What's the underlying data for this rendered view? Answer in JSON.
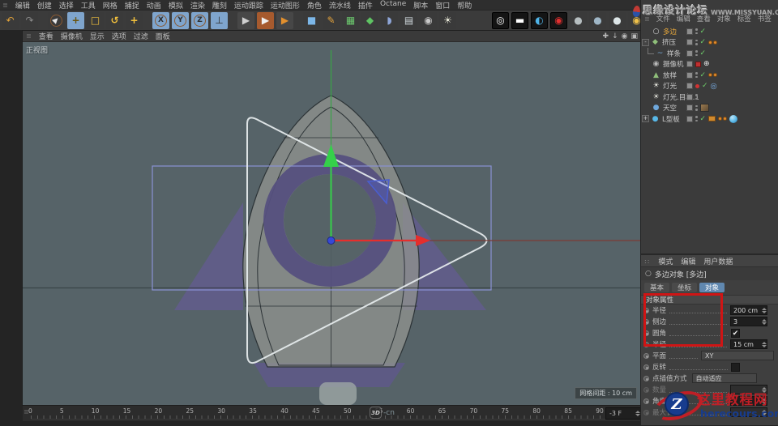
{
  "colors": {
    "highlight-red": "#cf1515",
    "viewport-bg": "#566368",
    "axis-green": "#35d04a",
    "axis-red": "#e62e2c",
    "spline-white": "#e6ecee",
    "workplane-blue": "#8a92d4",
    "fin-purple": "#615c8a",
    "selected-orange": "#e9a93c",
    "active-tab-blue": "#6088b0"
  },
  "menubar": {
    "items": [
      "编辑",
      "创建",
      "选择",
      "工具",
      "网格",
      "捕捉",
      "动画",
      "模拟",
      "渲染",
      "雕刻",
      "运动跟踪",
      "运动图形",
      "角色",
      "流水线",
      "插件",
      "Octane",
      "脚本",
      "窗口",
      "帮助"
    ]
  },
  "toolbar": {
    "icons": [
      {
        "name": "undo-icon",
        "glyph": "↶",
        "fg": "#e0a23a"
      },
      {
        "name": "redo-icon",
        "glyph": "↷",
        "fg": "#8a8a8a"
      },
      {
        "sep": true
      },
      {
        "name": "live-selection-icon",
        "glyph": "▶",
        "fg": "#e8e8e8",
        "ring": true,
        "rot": -45
      },
      {
        "name": "move-tool-icon",
        "glyph": "+",
        "fg": "#6a5510",
        "active": true,
        "bold": true
      },
      {
        "name": "scale-tool-icon",
        "glyph": "□",
        "fg": "#f2c03c",
        "bold": true
      },
      {
        "name": "rotate-tool-icon",
        "glyph": "↺",
        "fg": "#f2c03c",
        "bold": true
      },
      {
        "name": "last-tool-icon",
        "glyph": "+",
        "fg": "#f2c03c",
        "bold": true
      },
      {
        "sep": true
      },
      {
        "name": "x-axis-lock-icon",
        "glyph": "X",
        "fg": "#2e2e2e",
        "active": true,
        "ring": true
      },
      {
        "name": "y-axis-lock-icon",
        "glyph": "Y",
        "fg": "#2e2e2e",
        "active": true,
        "ring": true
      },
      {
        "name": "z-axis-lock-icon",
        "glyph": "Z",
        "fg": "#2e2e2e",
        "active": true,
        "ring": true
      },
      {
        "name": "coordinate-system-icon",
        "glyph": "⊥",
        "fg": "#2e2e2e",
        "active": true
      },
      {
        "sep": true
      },
      {
        "name": "render-view-icon",
        "glyph": "▶",
        "fg": "#cfcfcf",
        "bg": "#474747"
      },
      {
        "name": "render-picture-viewer-icon",
        "glyph": "▶",
        "fg": "#f0f0f0",
        "bg": "#a65a2e"
      },
      {
        "name": "render-settings-icon",
        "glyph": "▶",
        "fg": "#e2902e",
        "bg": "#474747"
      },
      {
        "sep": true
      },
      {
        "name": "cube-primitive-icon",
        "glyph": "■",
        "fg": "#7cb7e8"
      },
      {
        "name": "spline-pen-icon",
        "glyph": "✎",
        "fg": "#e2a23c"
      },
      {
        "name": "subdivision-surface-icon",
        "glyph": "▦",
        "fg": "#6cc96e"
      },
      {
        "name": "array-generator-icon",
        "glyph": "◆",
        "fg": "#5fc463"
      },
      {
        "name": "metaball-icon",
        "glyph": "◗",
        "fg": "#8fa6d8"
      },
      {
        "name": "floor-environment-icon",
        "glyph": "▤",
        "fg": "#cdd6da"
      },
      {
        "name": "camera-icon",
        "glyph": "◉",
        "fg": "#c9c9c9"
      },
      {
        "name": "light-icon",
        "glyph": "☀",
        "fg": "#e8e8d8"
      },
      {
        "gap": true
      },
      {
        "name": "octane-liveviewer-icon",
        "glyph": "◎",
        "fg": "#ffffff",
        "dark": true
      },
      {
        "name": "octane-exposure-icon",
        "glyph": "▬",
        "fg": "#ffffff",
        "dark": true
      },
      {
        "name": "octane-kernel-icon",
        "glyph": "◐",
        "fg": "#4fb4e8",
        "dark": true
      },
      {
        "name": "octane-camera-icon",
        "glyph": "◉",
        "fg": "#e23030",
        "dark": true
      },
      {
        "name": "material-diffuse-icon",
        "glyph": "●",
        "fg": "#b6bec0"
      },
      {
        "name": "material-glossy-icon",
        "glyph": "●",
        "fg": "#9fb6c6"
      },
      {
        "name": "material-specular-icon",
        "glyph": "●",
        "fg": "#dde6e8"
      },
      {
        "name": "axis-center-icon",
        "glyph": "◉",
        "fg": "#eec04a"
      },
      {
        "name": "arrange-arrows-icon",
        "glyph": "✚",
        "fg": "#e2852e"
      },
      {
        "name": "dynamics-gravity-icon",
        "glyph": "↓",
        "fg": "#e23030",
        "bold": true
      }
    ]
  },
  "viewport": {
    "menu_items": [
      "查看",
      "摄像机",
      "显示",
      "选项",
      "过滤",
      "面板"
    ],
    "controls": [
      {
        "name": "pan-viewport-icon",
        "glyph": "✚"
      },
      {
        "name": "zoom-viewport-icon",
        "glyph": "↓"
      },
      {
        "name": "rotate-viewport-icon",
        "glyph": "◉"
      },
      {
        "name": "maximize-viewport-icon",
        "glyph": "▣"
      }
    ],
    "view_label": "正视图",
    "grid_spacing_label": "网格间距 : 10 cm"
  },
  "timeline": {
    "frames": [
      0,
      5,
      10,
      15,
      20,
      25,
      30,
      35,
      40,
      45,
      50,
      55,
      60,
      65,
      70,
      75,
      80,
      85,
      90
    ],
    "frame_field": "-3 F"
  },
  "object_manager": {
    "menu_items": [
      "文件",
      "编辑",
      "查看",
      "对象",
      "标签",
      "书签"
    ],
    "objects": [
      {
        "label": "多边",
        "icon": "polygon-spline-icon",
        "glyph": "○",
        "color": "#d8d9da",
        "selected": true,
        "tags": [
          "layer",
          "dots",
          "check"
        ]
      },
      {
        "label": "挤压",
        "icon": "extrude-icon",
        "glyph": "◆",
        "color": "#8fbf7a",
        "expander": "-",
        "tags": [
          "layer",
          "dots",
          "check",
          "opair"
        ]
      },
      {
        "label": "样条",
        "icon": "spline-icon",
        "glyph": "~",
        "color": "#7ab0e0",
        "child": true,
        "tags": [
          "layer",
          "dots",
          "check"
        ]
      },
      {
        "label": "摄像机",
        "icon": "camera-object-icon",
        "glyph": "◉",
        "color": "#b9b9b9",
        "tags": [
          "layer",
          "redbox",
          "cross"
        ]
      },
      {
        "label": "放样",
        "icon": "loft-icon",
        "glyph": "▲",
        "color": "#8fbf7a",
        "tags": [
          "layer",
          "dots",
          "check",
          "opair"
        ]
      },
      {
        "label": "灯光",
        "icon": "light-object-icon",
        "glyph": "☀",
        "color": "#e8e8e0",
        "tags": [
          "layer",
          "reddot",
          "check",
          "target"
        ]
      },
      {
        "label": "灯光.目标.1",
        "icon": "target-light-icon",
        "glyph": "☀",
        "color": "#e8e8e0",
        "tags": [
          "layer",
          "dots"
        ]
      },
      {
        "label": "天空",
        "icon": "sky-object-icon",
        "glyph": "●",
        "color": "#6fa8dc",
        "tags": [
          "layer",
          "dots",
          "texture"
        ]
      },
      {
        "label": "L型板",
        "icon": "lboard-object-icon",
        "glyph": "●",
        "color": "#58b8e8",
        "expander": "+",
        "tags": [
          "layer",
          "dots",
          "check",
          "obox",
          "opair",
          "sphere"
        ]
      }
    ]
  },
  "attributes": {
    "mode_tabs": [
      "模式",
      "编辑",
      "用户数据"
    ],
    "object_title": "多边对象 [多边]",
    "sub_tabs": [
      {
        "label": "基本",
        "active": false
      },
      {
        "label": "坐标",
        "active": false
      },
      {
        "label": "对象",
        "active": true
      }
    ],
    "section": "对象属性",
    "rows": [
      {
        "label": "半径",
        "type": "stepper",
        "value": "200 cm"
      },
      {
        "label": "侧边",
        "type": "stepper",
        "value": "3"
      },
      {
        "label": "圆角",
        "type": "checkbox",
        "checked": true,
        "check_glyph": "✔"
      },
      {
        "label": "半径",
        "type": "stepper",
        "value": "15 cm"
      },
      {
        "label": "平面",
        "type": "dropdown",
        "value": "XY",
        "width": 90
      },
      {
        "label": "反转",
        "type": "checkbox",
        "checked": false
      },
      {
        "label": "点插值方式",
        "type": "dropdown",
        "value": "自动适应",
        "width": 80,
        "no_leader": true
      },
      {
        "label": "数量",
        "type": "stepper",
        "value": "",
        "disabled": true
      },
      {
        "label": "角度",
        "type": "stepper",
        "value": ""
      },
      {
        "label": "最大长度",
        "type": "stepper",
        "value": "",
        "disabled": true
      }
    ]
  },
  "watermarks": {
    "top": {
      "title": "思缘设计论坛",
      "url": "WWW.MISSYUAN.COM"
    },
    "timeline": {
      "logo": "3D",
      "suffix": "-cn"
    },
    "bottom": {
      "letter": "Z",
      "title": "这里教程网",
      "url": "herecours.com"
    }
  }
}
